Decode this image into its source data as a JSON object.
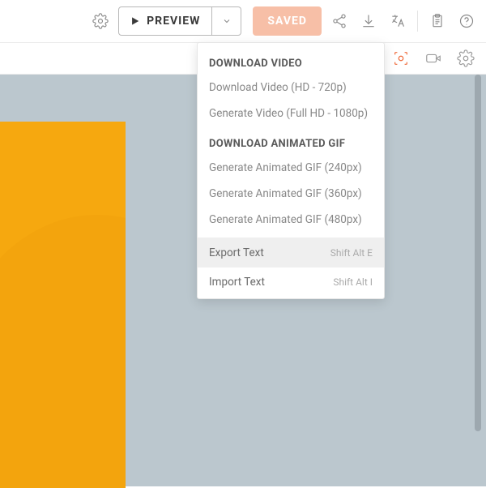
{
  "toolbar": {
    "preview_label": "PREVIEW",
    "saved_label": "SAVED"
  },
  "menu": {
    "section1_header": "DOWNLOAD VIDEO",
    "video_hd": "Download Video (HD - 720p)",
    "video_fullhd": "Generate Video (Full HD - 1080p)",
    "section2_header": "DOWNLOAD ANIMATED GIF",
    "gif_240": "Generate Animated GIF (240px)",
    "gif_360": "Generate Animated GIF (360px)",
    "gif_480": "Generate Animated GIF (480px)",
    "export_text": "Export Text",
    "export_shortcut": "Shift Alt E",
    "import_text": "Import Text",
    "import_shortcut": "Shift Alt I"
  }
}
